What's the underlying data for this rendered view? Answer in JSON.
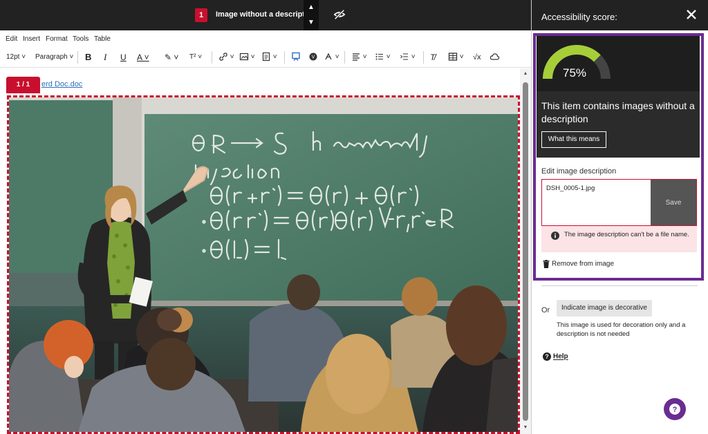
{
  "topbar": {
    "issue_count": "1",
    "issue_title": "Image without a description",
    "prev_icon": "chevron-up-icon",
    "next_icon": "chevron-down-icon",
    "visibility_icon": "eye-off-icon"
  },
  "menubar": {
    "items": [
      "Edit",
      "Insert",
      "Format",
      "Tools",
      "Table"
    ]
  },
  "toolbar": {
    "font_size": "12pt",
    "block_format": "Paragraph",
    "superscript_label": "T²"
  },
  "content": {
    "page_indicator": "1 / 1",
    "doc_link_text": "erd Doc.doc",
    "image_alt": "Lecturer writing on a chalkboard in front of students"
  },
  "panel": {
    "title": "Accessibility score:",
    "close_icon": "close-icon",
    "score_percent": 75,
    "score_label": "75%",
    "issue_message": "This item contains images without a description",
    "what_button": "What this means",
    "edit_label": "Edit image description",
    "description_value": "DSH_0005-1.jpg",
    "save_button": "Save",
    "error_text": "The image description can't be a file name.",
    "remove_label": "Remove from image",
    "or_label": "Or",
    "decorative_button": "Indicate image is decorative",
    "decorative_note": "This image is used for decoration only and a description is not needed",
    "help_label": "Help"
  },
  "colors": {
    "accent_purple": "#6a2c91",
    "error_red": "#c8102e",
    "gauge_green": "#a6ce39",
    "dark": "#222222"
  }
}
